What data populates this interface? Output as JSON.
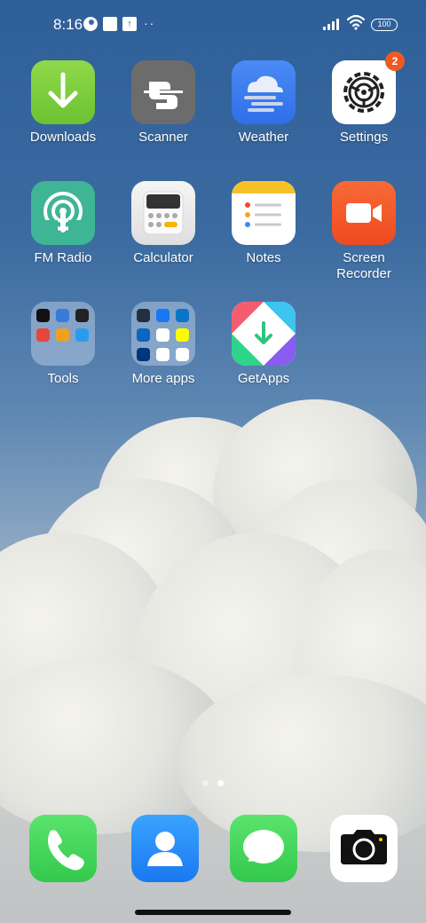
{
  "status_bar": {
    "time": "8:16",
    "dots": "··",
    "battery": "100"
  },
  "apps": [
    {
      "id": "downloads",
      "label": "Downloads",
      "color": "#7ccd3c",
      "icon": "download-arrow-icon"
    },
    {
      "id": "scanner",
      "label": "Scanner",
      "color": "#6b6b6b",
      "icon": "scanner-icon"
    },
    {
      "id": "weather",
      "label": "Weather",
      "color": "#3d7cf0",
      "icon": "cloud-icon"
    },
    {
      "id": "settings",
      "label": "Settings",
      "color": "#ffffff",
      "icon": "gear-icon",
      "badge": "2"
    },
    {
      "id": "fm_radio",
      "label": "FM Radio",
      "color": "#3fb696",
      "icon": "radio-icon"
    },
    {
      "id": "calculator",
      "label": "Calculator",
      "color": "#eeeeee",
      "icon": "calculator-icon"
    },
    {
      "id": "notes",
      "label": "Notes",
      "color": "#ffffff",
      "icon": "notes-icon"
    },
    {
      "id": "screen_recorder",
      "label_line1": "Screen",
      "label_line2": "Recorder",
      "color": "#f4582c",
      "icon": "video-camera-icon"
    },
    {
      "id": "tools",
      "label": "Tools",
      "icon": "folder-icon"
    },
    {
      "id": "more_apps",
      "label": "More apps",
      "icon": "folder-icon"
    },
    {
      "id": "getapps",
      "label": "GetApps",
      "icon": "getapps-icon"
    }
  ],
  "dock": [
    {
      "id": "phone",
      "color": "#43d65b",
      "icon": "phone-icon"
    },
    {
      "id": "contacts",
      "color": "#2c8ef8",
      "icon": "contact-icon"
    },
    {
      "id": "messages",
      "color": "#43d65b",
      "icon": "message-bubble-icon"
    },
    {
      "id": "camera",
      "color": "#ffffff",
      "icon": "camera-icon"
    }
  ],
  "page_indicator": {
    "pages": 2,
    "current": 2
  }
}
